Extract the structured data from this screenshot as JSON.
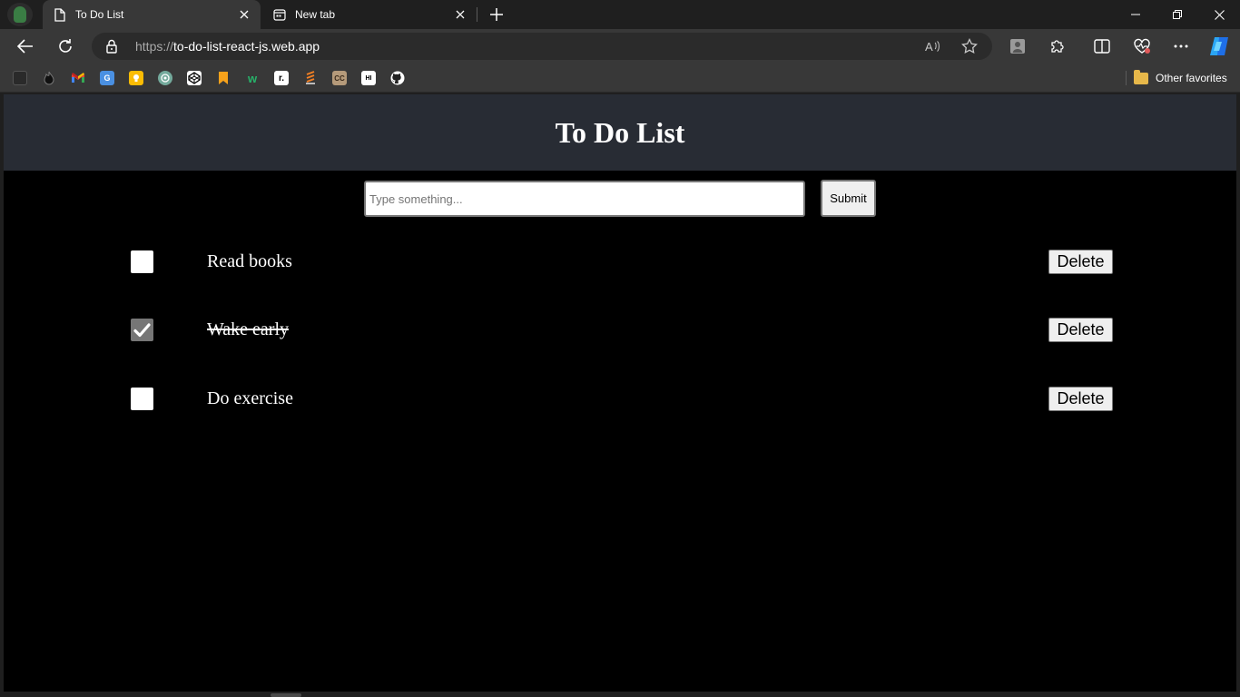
{
  "browser": {
    "tabs": [
      {
        "title": "To Do List",
        "icon": "page-icon",
        "active": true
      },
      {
        "title": "New tab",
        "icon": "newtab-icon",
        "active": false
      }
    ],
    "address": {
      "protocol": "https://",
      "host": "to-do-list-react-js.web.app"
    },
    "favorites_bar": {
      "items": [
        "folder-icon",
        "flame-icon",
        "gmail-icon",
        "translate-icon",
        "keep-icon",
        "chatgpt-icon",
        "codepen-icon",
        "bookmark-icon",
        "wattpad-icon",
        "readwise-icon",
        "stack-icon",
        "cc-icon",
        "hashnode-icon",
        "github-icon"
      ],
      "other_favorites_label": "Other favorites"
    }
  },
  "app": {
    "title": "To Do List",
    "input": {
      "placeholder": "Type something...",
      "value": ""
    },
    "submit_label": "Submit",
    "todos": [
      {
        "text": "Read books",
        "done": false,
        "delete_label": "Delete"
      },
      {
        "text": "Wake early",
        "done": true,
        "delete_label": "Delete"
      },
      {
        "text": "Do exercise",
        "done": false,
        "delete_label": "Delete"
      }
    ]
  },
  "colors": {
    "header_bg": "#282c34",
    "page_bg": "#000000",
    "browser_chrome": "#383838"
  }
}
